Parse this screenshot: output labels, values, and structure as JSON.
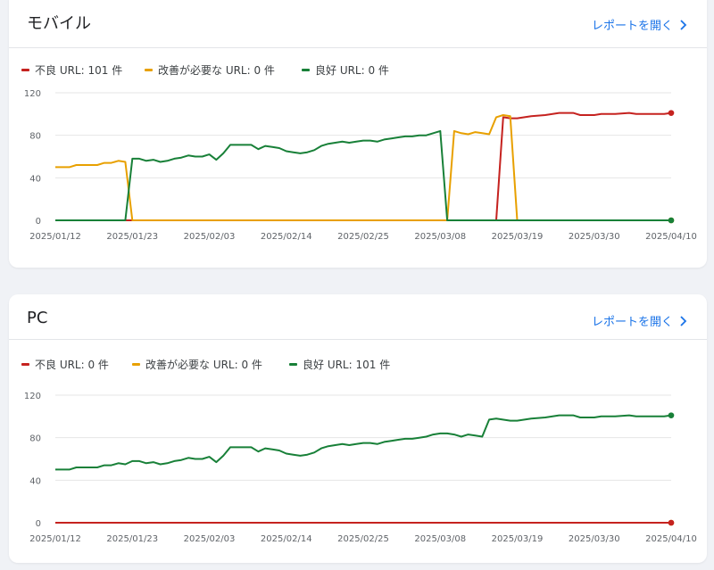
{
  "cards": [
    {
      "title": "モバイル",
      "link_label": "レポートを開く",
      "legend": [
        {
          "label": "不良 URL: 101 件",
          "color": "#c5221f"
        },
        {
          "label": "改善が必要な URL: 0 件",
          "color": "#e8a000"
        },
        {
          "label": "良好 URL: 0 件",
          "color": "#188038"
        }
      ]
    },
    {
      "title": "PC",
      "link_label": "レポートを開く",
      "legend": [
        {
          "label": "不良 URL: 0 件",
          "color": "#c5221f"
        },
        {
          "label": "改善が必要な URL: 0 件",
          "color": "#e8a000"
        },
        {
          "label": "良好 URL: 101 件",
          "color": "#188038"
        }
      ]
    }
  ],
  "icons": {
    "link": "chevron-right-icon"
  },
  "chart_data": [
    {
      "type": "line",
      "ylim": [
        0,
        120
      ],
      "yticks": [
        0,
        40,
        80,
        120
      ],
      "xtick_labels": [
        "2025/01/12",
        "2025/01/23",
        "2025/02/03",
        "2025/02/14",
        "2025/02/25",
        "2025/03/08",
        "2025/03/19",
        "2025/03/30",
        "2025/04/10"
      ],
      "x_start": "2025/01/12",
      "x_end": "2025/04/10",
      "series": [
        {
          "name": "不良 URL",
          "color": "#c5221f",
          "points": [
            [
              "2025/01/12",
              0
            ],
            [
              "2025/03/16",
              0
            ],
            [
              "2025/03/17",
              97
            ],
            [
              "2025/03/18",
              96
            ],
            [
              "2025/03/19",
              96
            ],
            [
              "2025/03/21",
              98
            ],
            [
              "2025/03/23",
              99
            ],
            [
              "2025/03/25",
              101
            ],
            [
              "2025/03/27",
              101
            ],
            [
              "2025/03/28",
              99
            ],
            [
              "2025/03/30",
              99
            ],
            [
              "2025/03/31",
              100
            ],
            [
              "2025/04/02",
              100
            ],
            [
              "2025/04/04",
              101
            ],
            [
              "2025/04/05",
              100
            ],
            [
              "2025/04/09",
              100
            ],
            [
              "2025/04/10",
              101
            ]
          ]
        },
        {
          "name": "改善が必要な URL",
          "color": "#e8a000",
          "points": [
            [
              "2025/01/12",
              50
            ],
            [
              "2025/01/14",
              50
            ],
            [
              "2025/01/15",
              52
            ],
            [
              "2025/01/18",
              52
            ],
            [
              "2025/01/19",
              54
            ],
            [
              "2025/01/20",
              54
            ],
            [
              "2025/01/21",
              56
            ],
            [
              "2025/01/22",
              55
            ],
            [
              "2025/01/23",
              0
            ],
            [
              "2025/03/09",
              0
            ],
            [
              "2025/03/10",
              84
            ],
            [
              "2025/03/11",
              82
            ],
            [
              "2025/03/12",
              81
            ],
            [
              "2025/03/13",
              83
            ],
            [
              "2025/03/14",
              82
            ],
            [
              "2025/03/15",
              81
            ],
            [
              "2025/03/16",
              97
            ],
            [
              "2025/03/17",
              99
            ],
            [
              "2025/03/18",
              98
            ],
            [
              "2025/03/19",
              0
            ],
            [
              "2025/04/10",
              0
            ]
          ]
        },
        {
          "name": "良好 URL",
          "color": "#188038",
          "points": [
            [
              "2025/01/12",
              0
            ],
            [
              "2025/01/22",
              0
            ],
            [
              "2025/01/23",
              58
            ],
            [
              "2025/01/24",
              58
            ],
            [
              "2025/01/25",
              56
            ],
            [
              "2025/01/26",
              57
            ],
            [
              "2025/01/27",
              55
            ],
            [
              "2025/01/28",
              56
            ],
            [
              "2025/01/29",
              58
            ],
            [
              "2025/01/30",
              59
            ],
            [
              "2025/01/31",
              61
            ],
            [
              "2025/02/01",
              60
            ],
            [
              "2025/02/02",
              60
            ],
            [
              "2025/02/03",
              62
            ],
            [
              "2025/02/04",
              57
            ],
            [
              "2025/02/05",
              63
            ],
            [
              "2025/02/06",
              71
            ],
            [
              "2025/02/07",
              71
            ],
            [
              "2025/02/09",
              71
            ],
            [
              "2025/02/10",
              67
            ],
            [
              "2025/02/11",
              70
            ],
            [
              "2025/02/12",
              69
            ],
            [
              "2025/02/13",
              68
            ],
            [
              "2025/02/14",
              65
            ],
            [
              "2025/02/15",
              64
            ],
            [
              "2025/02/16",
              63
            ],
            [
              "2025/02/17",
              64
            ],
            [
              "2025/02/18",
              66
            ],
            [
              "2025/02/19",
              70
            ],
            [
              "2025/02/20",
              72
            ],
            [
              "2025/02/21",
              73
            ],
            [
              "2025/02/22",
              74
            ],
            [
              "2025/02/23",
              73
            ],
            [
              "2025/02/24",
              74
            ],
            [
              "2025/02/25",
              75
            ],
            [
              "2025/02/26",
              75
            ],
            [
              "2025/02/27",
              74
            ],
            [
              "2025/02/28",
              76
            ],
            [
              "2025/03/01",
              77
            ],
            [
              "2025/03/02",
              78
            ],
            [
              "2025/03/03",
              79
            ],
            [
              "2025/03/04",
              79
            ],
            [
              "2025/03/05",
              80
            ],
            [
              "2025/03/06",
              80
            ],
            [
              "2025/03/07",
              82
            ],
            [
              "2025/03/08",
              84
            ],
            [
              "2025/03/09",
              0
            ],
            [
              "2025/04/10",
              0
            ]
          ]
        }
      ]
    },
    {
      "type": "line",
      "ylim": [
        0,
        120
      ],
      "yticks": [
        0,
        40,
        80,
        120
      ],
      "xtick_labels": [
        "2025/01/12",
        "2025/01/23",
        "2025/02/03",
        "2025/02/14",
        "2025/02/25",
        "2025/03/08",
        "2025/03/19",
        "2025/03/30",
        "2025/04/10"
      ],
      "x_start": "2025/01/12",
      "x_end": "2025/04/10",
      "series": [
        {
          "name": "改善が必要な URL",
          "color": "#e8a000",
          "points": [
            [
              "2025/01/12",
              0
            ],
            [
              "2025/04/10",
              0
            ]
          ]
        },
        {
          "name": "良好 URL",
          "color": "#188038",
          "points": [
            [
              "2025/01/12",
              50
            ],
            [
              "2025/01/14",
              50
            ],
            [
              "2025/01/15",
              52
            ],
            [
              "2025/01/18",
              52
            ],
            [
              "2025/01/19",
              54
            ],
            [
              "2025/01/20",
              54
            ],
            [
              "2025/01/21",
              56
            ],
            [
              "2025/01/22",
              55
            ],
            [
              "2025/01/23",
              58
            ],
            [
              "2025/01/24",
              58
            ],
            [
              "2025/01/25",
              56
            ],
            [
              "2025/01/26",
              57
            ],
            [
              "2025/01/27",
              55
            ],
            [
              "2025/01/28",
              56
            ],
            [
              "2025/01/29",
              58
            ],
            [
              "2025/01/30",
              59
            ],
            [
              "2025/01/31",
              61
            ],
            [
              "2025/02/01",
              60
            ],
            [
              "2025/02/02",
              60
            ],
            [
              "2025/02/03",
              62
            ],
            [
              "2025/02/04",
              57
            ],
            [
              "2025/02/05",
              63
            ],
            [
              "2025/02/06",
              71
            ],
            [
              "2025/02/07",
              71
            ],
            [
              "2025/02/09",
              71
            ],
            [
              "2025/02/10",
              67
            ],
            [
              "2025/02/11",
              70
            ],
            [
              "2025/02/12",
              69
            ],
            [
              "2025/02/13",
              68
            ],
            [
              "2025/02/14",
              65
            ],
            [
              "2025/02/15",
              64
            ],
            [
              "2025/02/16",
              63
            ],
            [
              "2025/02/17",
              64
            ],
            [
              "2025/02/18",
              66
            ],
            [
              "2025/02/19",
              70
            ],
            [
              "2025/02/20",
              72
            ],
            [
              "2025/02/21",
              73
            ],
            [
              "2025/02/22",
              74
            ],
            [
              "2025/02/23",
              73
            ],
            [
              "2025/02/24",
              74
            ],
            [
              "2025/02/25",
              75
            ],
            [
              "2025/02/26",
              75
            ],
            [
              "2025/02/27",
              74
            ],
            [
              "2025/02/28",
              76
            ],
            [
              "2025/03/01",
              77
            ],
            [
              "2025/03/02",
              78
            ],
            [
              "2025/03/03",
              79
            ],
            [
              "2025/03/04",
              79
            ],
            [
              "2025/03/05",
              80
            ],
            [
              "2025/03/06",
              81
            ],
            [
              "2025/03/07",
              83
            ],
            [
              "2025/03/08",
              84
            ],
            [
              "2025/03/09",
              84
            ],
            [
              "2025/03/10",
              83
            ],
            [
              "2025/03/11",
              81
            ],
            [
              "2025/03/12",
              83
            ],
            [
              "2025/03/13",
              82
            ],
            [
              "2025/03/14",
              81
            ],
            [
              "2025/03/15",
              97
            ],
            [
              "2025/03/16",
              98
            ],
            [
              "2025/03/18",
              96
            ],
            [
              "2025/03/19",
              96
            ],
            [
              "2025/03/21",
              98
            ],
            [
              "2025/03/23",
              99
            ],
            [
              "2025/03/25",
              101
            ],
            [
              "2025/03/27",
              101
            ],
            [
              "2025/03/28",
              99
            ],
            [
              "2025/03/30",
              99
            ],
            [
              "2025/03/31",
              100
            ],
            [
              "2025/04/02",
              100
            ],
            [
              "2025/04/04",
              101
            ],
            [
              "2025/04/05",
              100
            ],
            [
              "2025/04/09",
              100
            ],
            [
              "2025/04/10",
              101
            ]
          ]
        },
        {
          "name": "不良 URL",
          "color": "#c5221f",
          "points": [
            [
              "2025/01/12",
              0
            ],
            [
              "2025/04/10",
              0
            ]
          ]
        }
      ]
    }
  ]
}
